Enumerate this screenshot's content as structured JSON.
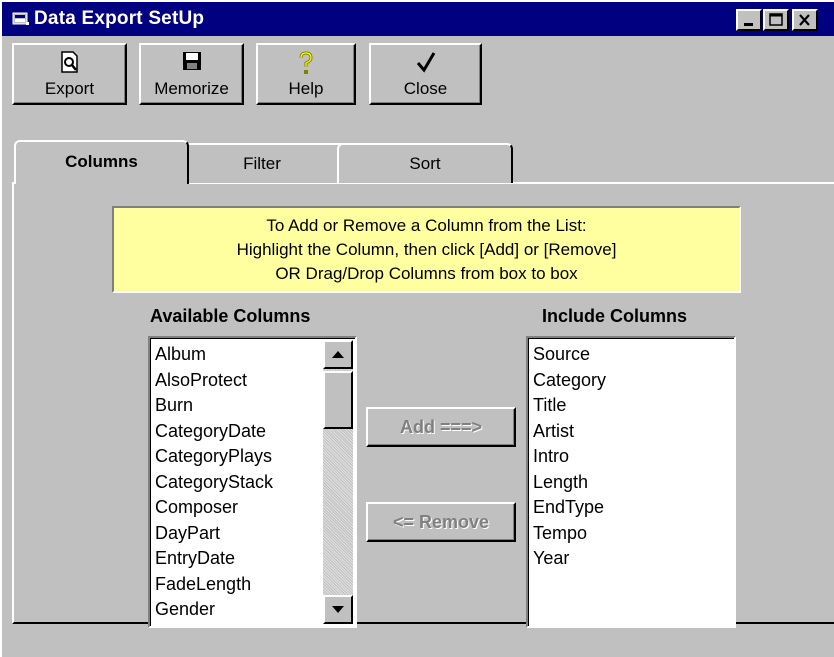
{
  "window": {
    "title": "Data Export SetUp",
    "controls": [
      "minimize-icon",
      "maximize-icon",
      "close-icon"
    ]
  },
  "toolbar": {
    "export_label": "Export",
    "memorize_label": "Memorize",
    "help_label": "Help",
    "close_label": "Close"
  },
  "tabs": [
    {
      "label": "Columns",
      "active": true
    },
    {
      "label": "Filter",
      "active": false
    },
    {
      "label": "Sort",
      "active": false
    }
  ],
  "hint": {
    "line1": "To Add or Remove a Column from the List:",
    "line2": "Highlight the Column, then click  [Add] or [Remove]",
    "line3": "OR   Drag/Drop Columns from box to box"
  },
  "available": {
    "heading": "Available Columns",
    "items": [
      "Album",
      "AlsoProtect",
      "Burn",
      "CategoryDate",
      "CategoryPlays",
      "CategoryStack",
      "Composer",
      "DayPart",
      "EntryDate",
      "FadeLength",
      "Gender"
    ]
  },
  "included": {
    "heading": "Include Columns",
    "items": [
      "Source",
      "Category",
      "Title",
      "Artist",
      "Intro",
      "Length",
      "EndType",
      "Tempo",
      "Year"
    ]
  },
  "buttons": {
    "add_label": "Add  ===>",
    "remove_label": "<= Remove"
  },
  "colors": {
    "titlebar": "#000080",
    "face": "#c0c0c0",
    "hint_bg": "#ffffa0",
    "disabled_text": "#808080"
  }
}
